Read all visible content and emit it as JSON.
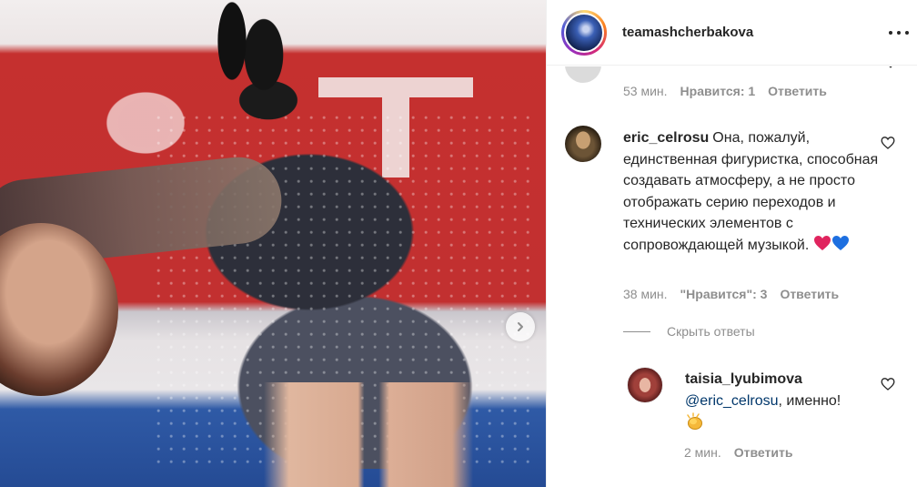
{
  "post": {
    "username": "teamashcherbakova"
  },
  "previous_comment": {
    "time": "53 мин.",
    "likes": "Нравится: 1",
    "reply": "Ответить"
  },
  "main_comment": {
    "username": "eric_celrosu",
    "text": "Она, пожалуй, единственная фигуристка, способная создавать атмосферу, а не просто отображать серию переходов и технических элементов с сопровождающей музыкой.",
    "emojis": [
      "red-heart",
      "blue-heart"
    ],
    "time": "38 мин.",
    "likes": "\"Нравится\": 3",
    "reply": "Ответить"
  },
  "hide_replies_label": "Скрыть ответы",
  "reply_comment": {
    "username": "taisia_lyubimova",
    "mention": "@eric_celrosu",
    "text": ", именно!",
    "emoji": "clapping-hands",
    "time": "2 мин.",
    "reply": "Ответить"
  },
  "colors": {
    "text": "#262626",
    "secondary": "#8e8e8e",
    "mention": "#00376b",
    "red_heart": "#e0245e",
    "blue_heart": "#1d6fe0"
  }
}
